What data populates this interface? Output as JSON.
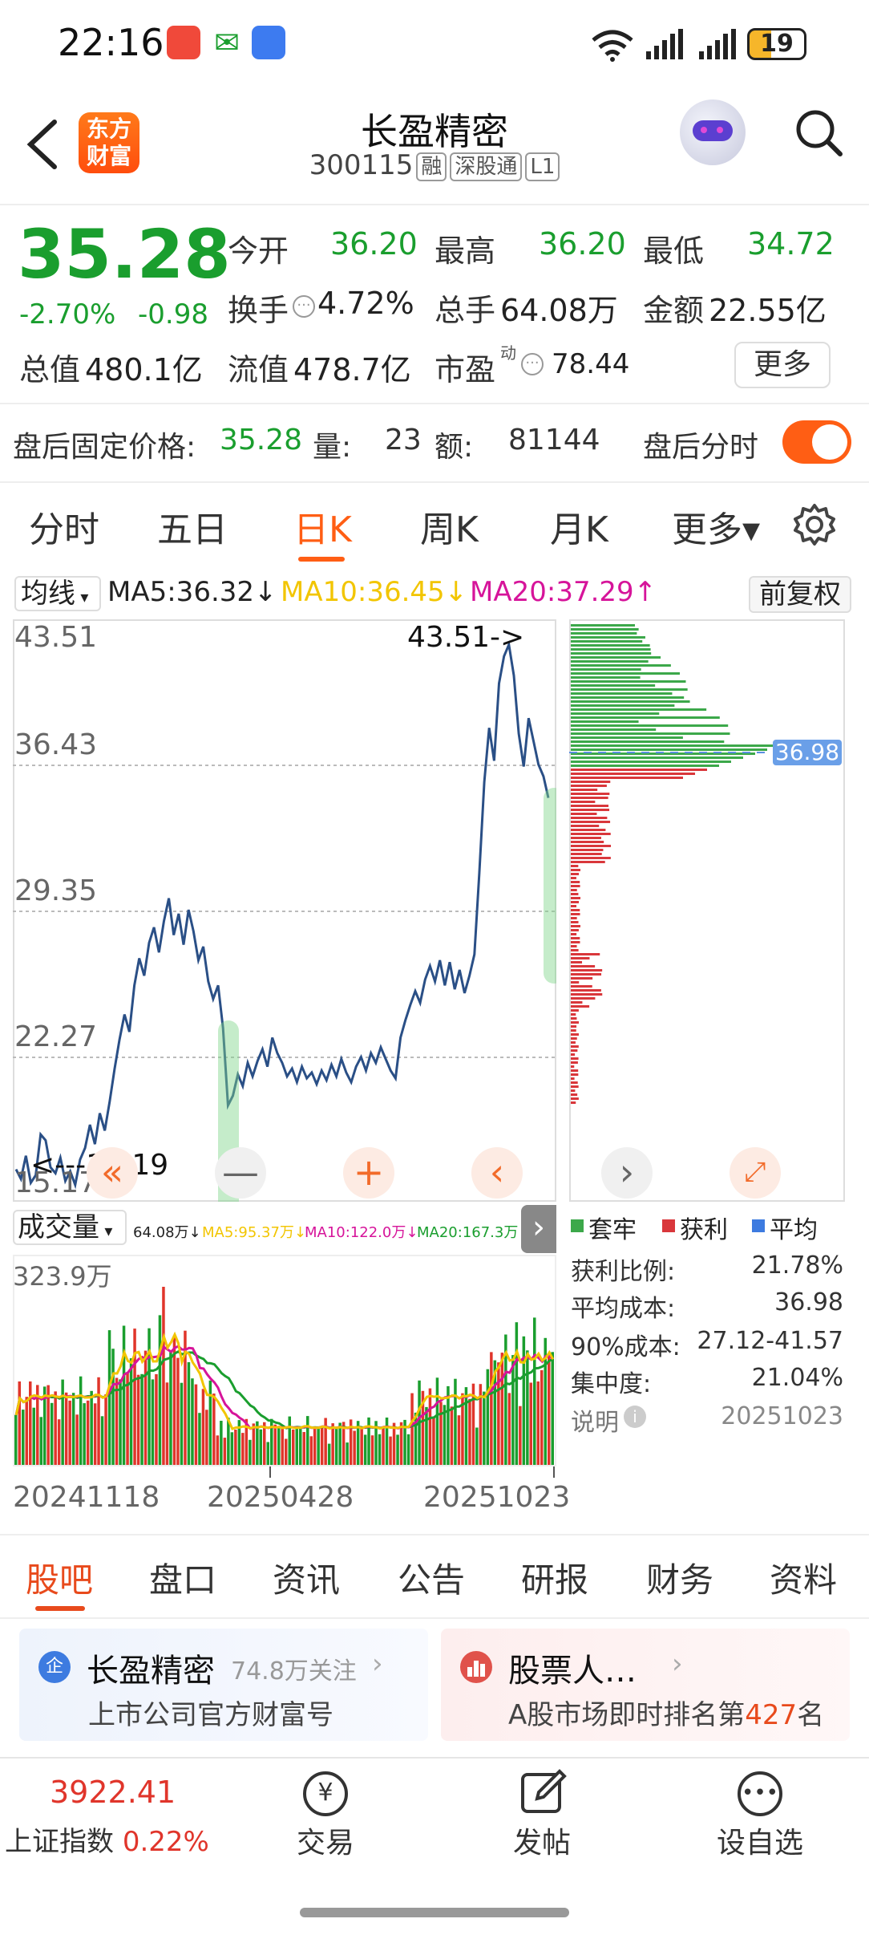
{
  "status_bar": {
    "time": "22:16",
    "battery": "19",
    "icons": [
      "notification-app-icon",
      "china-post-icon",
      "shield-app-icon",
      "wifi-icon",
      "signal-icon",
      "signal-icon"
    ]
  },
  "header": {
    "app_logo_line1": "东方",
    "app_logo_line2": "财富",
    "stock_name": "长盈精密",
    "stock_code": "300115",
    "tags": [
      "融",
      "深股通",
      "L1"
    ]
  },
  "quote": {
    "price": "35.28",
    "change_pct": "-2.70%",
    "change_amt": "-0.98",
    "open_label": "今开",
    "open": "36.20",
    "high_label": "最高",
    "high": "36.20",
    "low_label": "最低",
    "low": "34.72",
    "turnover_label": "换手",
    "turnover": "4.72%",
    "volume_label": "总手",
    "volume": "64.08万",
    "amount_label": "金额",
    "amount": "22.55亿",
    "total_cap_label": "总值",
    "total_cap": "480.1亿",
    "float_cap_label": "流值",
    "float_cap": "478.7亿",
    "pe_label": "市盈",
    "pe_sup": "动",
    "pe": "78.44",
    "more_label": "更多"
  },
  "after_hours": {
    "price_label": "盘后固定价格:",
    "price": "35.28",
    "vol_label": "量:",
    "vol": "23",
    "amt_label": "额:",
    "amt": "81144",
    "toggle_label": "盘后分时"
  },
  "chart_tabs": [
    "分时",
    "五日",
    "日K",
    "周K",
    "月K",
    "更多▾"
  ],
  "ma_bar": {
    "selector": "均线",
    "ma5": "MA5:36.32↓",
    "ma10": "MA10:36.45↓",
    "ma20": "MA20:37.29↑",
    "fq": "前复权"
  },
  "chart_data": {
    "type": "line",
    "title": "",
    "yticks": [
      "43.51",
      "36.43",
      "29.35",
      "22.27",
      "15.17"
    ],
    "ylim": [
      15.17,
      43.51
    ],
    "x_labels": [
      "20241118",
      "20250428",
      "20251023"
    ],
    "max_annotation": "43.51->",
    "min_annotation": "<---15.19",
    "close_series": [
      16.1,
      15.6,
      16.8,
      15.4,
      15.8,
      17.9,
      17.6,
      16.2,
      15.9,
      16.7,
      15.5,
      16.0,
      15.3,
      16.6,
      17.2,
      18.4,
      17.4,
      19.0,
      18.1,
      19.6,
      21.3,
      22.8,
      24.1,
      23.2,
      25.6,
      27.0,
      26.1,
      27.8,
      28.6,
      27.3,
      28.9,
      30.1,
      28.2,
      29.3,
      27.7,
      29.5,
      28.4,
      26.9,
      27.6,
      25.8,
      24.9,
      25.6,
      23.4,
      19.4,
      19.9,
      21.0,
      20.4,
      21.6,
      20.9,
      21.7,
      22.3,
      21.4,
      22.9,
      22.1,
      21.6,
      20.9,
      21.3,
      20.6,
      21.4,
      20.8,
      21.1,
      20.5,
      21.2,
      20.7,
      21.5,
      20.9,
      21.8,
      21.1,
      20.6,
      21.4,
      21.9,
      21.2,
      22.1,
      21.6,
      22.4,
      21.8,
      21.2,
      20.8,
      22.9,
      23.8,
      24.6,
      25.3,
      24.7,
      25.9,
      26.6,
      25.8,
      26.9,
      25.6,
      26.8,
      25.4,
      26.4,
      25.2,
      26.1,
      27.2,
      31.4,
      36.1,
      38.9,
      37.2,
      41.2,
      42.6,
      43.2,
      41.6,
      38.6,
      36.9,
      39.4,
      38.2,
      37.0,
      36.4,
      35.28
    ],
    "chip_marker": "36.98",
    "volume": {
      "label": "成交量",
      "vol": "64.08万↓",
      "ma5": "MA5:95.37万↓",
      "ma10": "MA10:122.0万↓",
      "ma20": "MA20:167.3万↓",
      "max_label": "323.9万"
    }
  },
  "chip_stats": {
    "legend": [
      "套牢",
      "获利",
      "平均"
    ],
    "profit_ratio_label": "获利比例:",
    "profit_ratio": "21.78%",
    "avg_cost_label": "平均成本:",
    "avg_cost": "36.98",
    "cost90_label": "90%成本:",
    "cost90": "27.12-41.57",
    "concentration_label": "集中度:",
    "concentration": "21.04%",
    "note_label": "说明",
    "date": "20251023"
  },
  "bottom_tabs": [
    "股吧",
    "盘口",
    "资讯",
    "公告",
    "研报",
    "财务",
    "资料"
  ],
  "cards": {
    "left_name": "长盈精密",
    "left_follow": "74.8万关注",
    "left_sub": "上市公司官方财富号",
    "right_title": "股票人…",
    "right_sub_pre": "A股市场即时排名第",
    "right_rank": "427",
    "right_sub_post": "名"
  },
  "bottom_nav": {
    "index_value": "3922.41",
    "index_name": "上证指数",
    "index_change": "0.22%",
    "trade": "交易",
    "post": "发帖",
    "watchlist": "设自选"
  },
  "colors": {
    "accent": "#ff5e14",
    "down": "#1a9e2e",
    "up": "#e0352b",
    "ma5": "#f2c500",
    "ma20": "#d6149a"
  }
}
